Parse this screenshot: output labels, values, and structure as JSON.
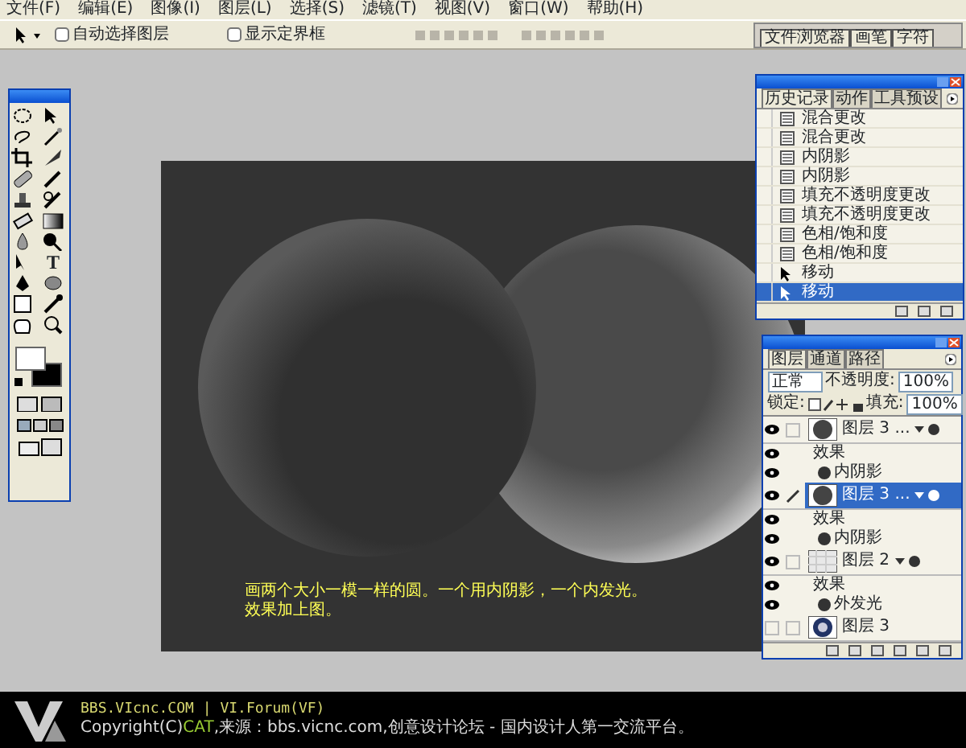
{
  "menu_bar": [
    {
      "label": "文件(F)"
    },
    {
      "label": "编辑(E)"
    },
    {
      "label": "图像(I)"
    },
    {
      "label": "图层(L)"
    },
    {
      "label": "选择(S)"
    },
    {
      "label": "滤镜(T)"
    },
    {
      "label": "视图(V)"
    },
    {
      "label": "窗口(W)"
    },
    {
      "label": "帮助(H)"
    }
  ],
  "options_bar": {
    "checkboxes": [
      {
        "label": "自动选择图层",
        "checked": false
      },
      {
        "label": "显示定界框",
        "checked": false
      }
    ]
  },
  "palette_well": {
    "tabs": [
      {
        "label": "文件浏览器"
      },
      {
        "label": "画笔"
      },
      {
        "label": "字符"
      }
    ]
  },
  "toolbox": {
    "type_tool_glyph": "T"
  },
  "canvas": {
    "caption_lines": [
      "画两个大小一模一样的圆。一个用内阴影，一个内发光。",
      "效果加上图。"
    ]
  },
  "history_panel": {
    "tabs": [
      {
        "label": "历史记录",
        "selected": true
      },
      {
        "label": "动作",
        "selected": false
      },
      {
        "label": "工具预设",
        "selected": false
      }
    ],
    "items": [
      {
        "label": "混合更改",
        "kind": "step",
        "selected": false
      },
      {
        "label": "混合更改",
        "kind": "step",
        "selected": false
      },
      {
        "label": "内阴影",
        "kind": "step",
        "selected": false
      },
      {
        "label": "内阴影",
        "kind": "step",
        "selected": false
      },
      {
        "label": "填充不透明度更改",
        "kind": "step",
        "selected": false
      },
      {
        "label": "填充不透明度更改",
        "kind": "step",
        "selected": false
      },
      {
        "label": "色相/饱和度",
        "kind": "step",
        "selected": false
      },
      {
        "label": "色相/饱和度",
        "kind": "step",
        "selected": false
      },
      {
        "label": "移动",
        "kind": "move",
        "selected": false
      },
      {
        "label": "移动",
        "kind": "move",
        "selected": true
      }
    ]
  },
  "layers_panel": {
    "tabs": [
      {
        "label": "图层",
        "selected": true
      },
      {
        "label": "通道",
        "selected": false
      },
      {
        "label": "路径",
        "selected": false
      }
    ],
    "blend_mode": "正常",
    "opacity_label": "不透明度:",
    "opacity": "100%",
    "lock_label": "锁定:",
    "fill_label": "填充:",
    "fill": "100%",
    "layers": [
      {
        "name": "图层 3 ...",
        "kind": "shape",
        "selected": false,
        "visible": true,
        "effects_label": "效果",
        "effects": [
          {
            "name": "内阴影",
            "visible": true
          }
        ]
      },
      {
        "name": "图层 3 ...",
        "kind": "shape",
        "selected": true,
        "visible": true,
        "effects_label": "效果",
        "effects": [
          {
            "name": "内阴影",
            "visible": true
          }
        ]
      },
      {
        "name": "图层 2",
        "kind": "transparent",
        "selected": false,
        "visible": true,
        "effects_label": "效果",
        "effects": [
          {
            "name": "外发光",
            "visible": true
          }
        ]
      },
      {
        "name": "图层 3",
        "kind": "emblem",
        "selected": false,
        "visible": false
      }
    ]
  },
  "footer": {
    "line1": "BBS.VIcnc.COM | VI.Forum(VF)",
    "line2": [
      {
        "text": "Copyright(C)",
        "highlight": false
      },
      {
        "text": "CAT",
        "highlight": true
      },
      {
        "text": ",来源：bbs.vicnc.com,创意设计论坛 - 国内设计人第一交流平台。",
        "highlight": false
      }
    ]
  }
}
